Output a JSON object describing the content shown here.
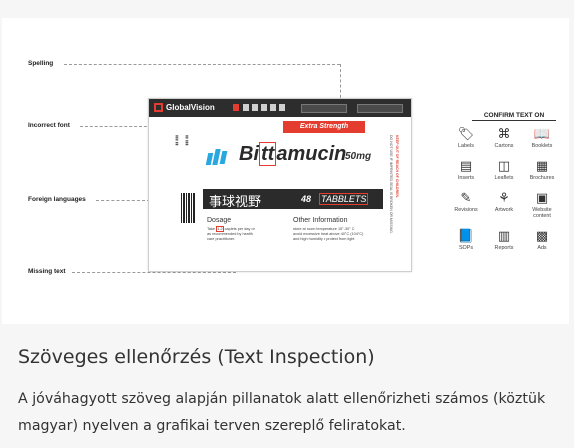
{
  "callouts": {
    "spelling": "Spelling",
    "incorrect_font": "Incorrect font",
    "foreign_languages": "Foreign languages",
    "missing_text": "Missing text"
  },
  "app": {
    "logo": "GlobalVision",
    "accent": "#e43d30"
  },
  "label": {
    "extra": "Extra Strength",
    "brand_pre": "Bi",
    "brand_box": "tt",
    "brand_post": "amucin",
    "dose": "50mg",
    "cjk": "事球视野",
    "tablets_count": "48",
    "tablets_word": "TABBLETS",
    "dosage_title": "Dosage",
    "dosage_text_1": "Take",
    "dosage_box": "1-2",
    "dosage_text_2": "caplets per day or",
    "dosage_text_3": "as recommended by health",
    "dosage_text_4": "care practitioner.",
    "other_title": "Other Information",
    "other_text_1": "store at room temperature 15°-30° C",
    "other_text_2": "avoid excessive heat above 40°C (104°C)",
    "other_text_3": "and high humidity • protect from light",
    "side_right_1": "DO NOT USE IF IMPRINTED SEAL IS BROKEN OR MISSING.",
    "side_right_2": "KEEP OUT OF REACH OF CHILDREN."
  },
  "confirm": {
    "title": "CONFIRM TEXT ON",
    "items": [
      {
        "label": "Labels",
        "icon": "labels-icon",
        "glyph": "🏷"
      },
      {
        "label": "Cartons",
        "icon": "cartons-icon",
        "glyph": "⌘"
      },
      {
        "label": "Booklets",
        "icon": "booklets-icon",
        "glyph": "📖"
      },
      {
        "label": "Inserts",
        "icon": "inserts-icon",
        "glyph": "▤"
      },
      {
        "label": "Leaflets",
        "icon": "leaflets-icon",
        "glyph": "◫"
      },
      {
        "label": "Brochures",
        "icon": "brochures-icon",
        "glyph": "▦"
      },
      {
        "label": "Revisions",
        "icon": "revisions-icon",
        "glyph": "✎"
      },
      {
        "label": "Artwork",
        "icon": "artwork-icon",
        "glyph": "⚘"
      },
      {
        "label": "Website content",
        "icon": "website-content-icon",
        "glyph": "▣"
      },
      {
        "label": "SOPs",
        "icon": "sops-icon",
        "glyph": "📘"
      },
      {
        "label": "Reports",
        "icon": "reports-icon",
        "glyph": "▥"
      },
      {
        "label": "Ads",
        "icon": "ads-icon",
        "glyph": "▩"
      }
    ]
  },
  "caption": {
    "heading": "Szöveges ellenőrzés (Text Inspection)",
    "paragraph": "A jóváhagyott szöveg alapján pillanatok alatt ellenőrizheti számos (köztük magyar) nyelven a grafikai terven szereplő feliratokat."
  }
}
